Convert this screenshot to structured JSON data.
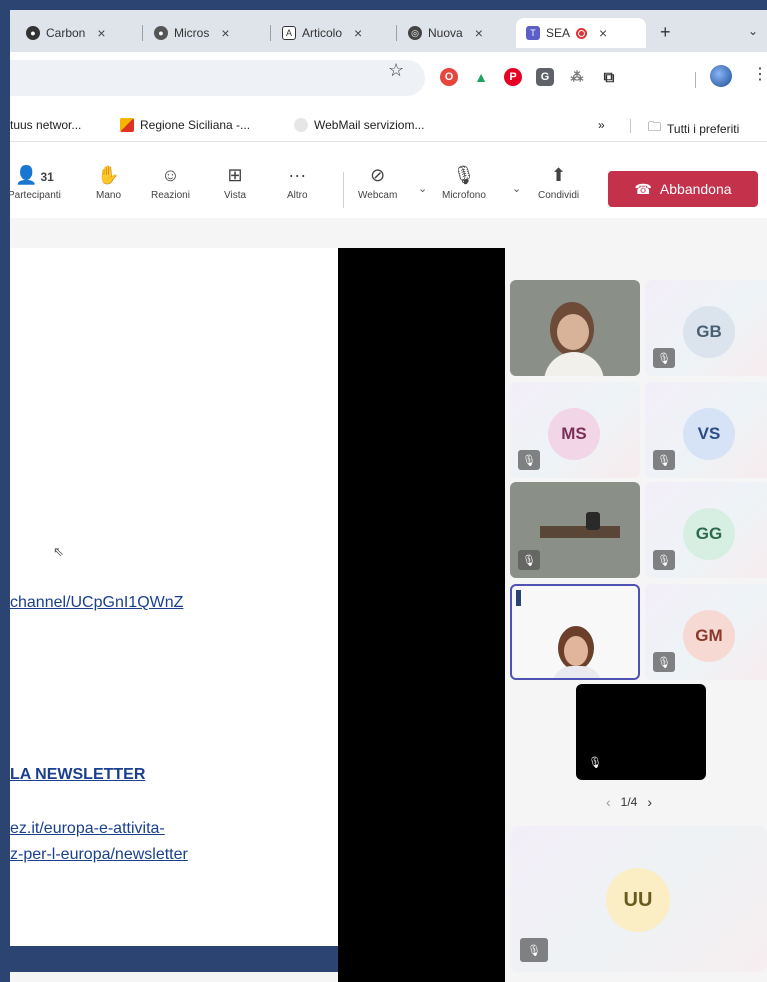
{
  "browser": {
    "tabs": [
      {
        "label": "Carbon",
        "icon": "carbon-icon"
      },
      {
        "label": "Micros",
        "icon": "microsoft-icon"
      },
      {
        "label": "Articolo",
        "icon": "articolo-icon"
      },
      {
        "label": "Nuova",
        "icon": "chrome-icon"
      },
      {
        "label": "SEA",
        "icon": "teams-icon",
        "active": true
      }
    ],
    "new_tab": "+",
    "tab_menu": "⌄"
  },
  "bookmarks": [
    {
      "label": "tuus networ..."
    },
    {
      "label": "Regione Siciliana -..."
    },
    {
      "label": "WebMail serviziom..."
    },
    {
      "label": "»"
    },
    {
      "label": "Tutti i preferiti"
    }
  ],
  "teams_toolbar": {
    "participants_count": "31",
    "participants": "Partecipanti",
    "hand": "Mano",
    "reactions": "Reazioni",
    "view": "Vista",
    "more": "Altro",
    "webcam": "Webcam",
    "microphone": "Microfono",
    "share": "Condividi",
    "leave": "Abbandona"
  },
  "slide": {
    "link1": "channel/UCpGnI1QWnZ",
    "newsletter": "LA NEWSLETTER",
    "link2a": "ez.it/europa-e-attivita-",
    "link2b": "z-per-l-europa/newsletter"
  },
  "participants": {
    "gb": "GB",
    "ms": "MS",
    "vs": "VS",
    "gg": "GG",
    "gm": "GM",
    "uu": "UU"
  },
  "pager": {
    "prev": "‹",
    "label": "1/4",
    "next": "›"
  },
  "colors": {
    "leave": "#c4314b",
    "brand": "#2b4471",
    "link": "#1a3f8f",
    "spotlight": "#4f52b2"
  }
}
